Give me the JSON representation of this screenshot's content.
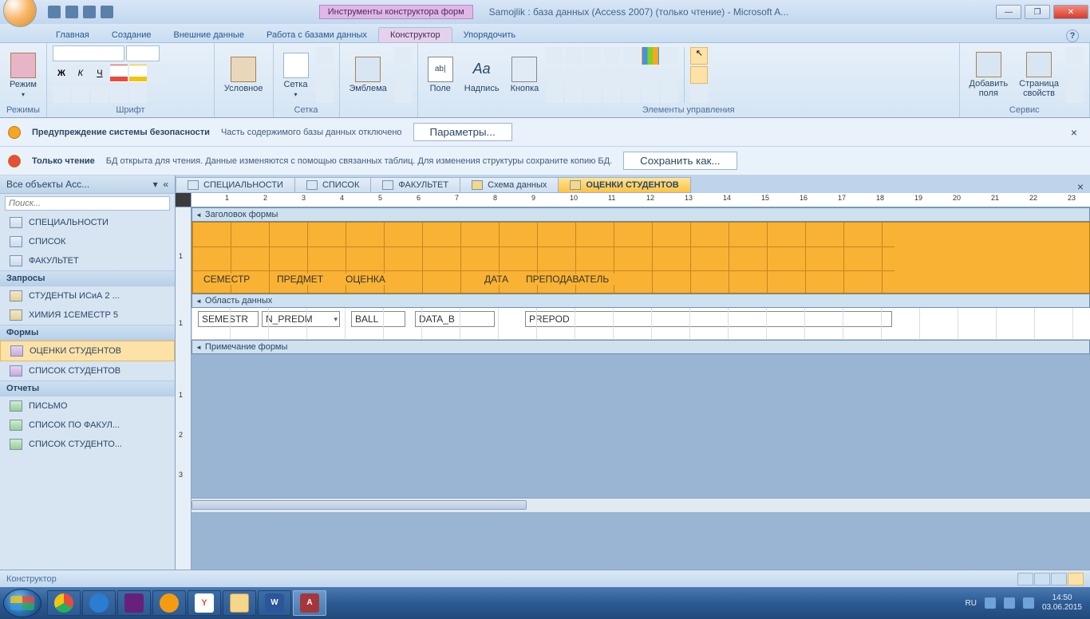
{
  "titlebar": {
    "context_label": "Инструменты конструктора форм",
    "app_title": "Samojlik : база данных (Access 2007) (только чтение) - Microsoft A..."
  },
  "ribbon_tabs": {
    "t0": "Главная",
    "t1": "Создание",
    "t2": "Внешние данные",
    "t3": "Работа с базами данных",
    "t4": "Конструктор",
    "t5": "Упорядочить"
  },
  "ribbon": {
    "mode": "Режим",
    "g_modes": "Режимы",
    "bold": "Ж",
    "italic": "К",
    "underline": "Ч",
    "g_font": "Шрифт",
    "cond": "Условное",
    "grid": "Сетка",
    "g_grid": "Сетка",
    "emblem": "Эмблема",
    "g_emblem": "",
    "field": "Поле",
    "label": "Надпись",
    "button": "Кнопка",
    "aa": "Aa",
    "g_controls": "Элементы управления",
    "addf": "Добавить\nполя",
    "props": "Страница\nсвойств",
    "g_service": "Сервис"
  },
  "warnings": {
    "sec_title": "Предупреждение системы безопасности",
    "sec_text": "Часть содержимого базы данных отключено",
    "sec_btn": "Параметры...",
    "ro_title": "Только чтение",
    "ro_text": "БД открыта для чтения. Данные изменяются с помощью связанных таблиц. Для изменения структуры сохраните копию БД.",
    "ro_btn": "Сохранить как..."
  },
  "nav": {
    "header": "Все объекты Acc...",
    "search_ph": "Поиск...",
    "sec_tables": "",
    "t0": "СПЕЦИАЛЬНОСТИ",
    "t1": "СПИСОК",
    "t2": "ФАКУЛЬТЕТ",
    "sec_queries": "Запросы",
    "q0": "СТУДЕНТЫ ИСиА 2 ...",
    "q1": "ХИМИЯ 1СЕМЕСТР 5",
    "sec_forms": "Формы",
    "f0": "ОЦЕНКИ СТУДЕНТОВ",
    "f1": "СПИСОК СТУДЕНТОВ",
    "sec_reports": "Отчеты",
    "r0": "ПИСЬМО",
    "r1": "СПИСОК ПО ФАКУЛ...",
    "r2": "СПИСОК СТУДЕНТО..."
  },
  "doctabs": {
    "d0": "СПЕЦИАЛЬНОСТИ",
    "d1": "СПИСОК",
    "d2": "ФАКУЛЬТЕТ",
    "d3": "Схема данных",
    "d4": "ОЦЕНКИ СТУДЕНТОВ"
  },
  "sections": {
    "header": "Заголовок формы",
    "detail": "Область данных",
    "footer": "Примечание формы"
  },
  "header_labels": {
    "l0": "СЕМЕСТР",
    "l1": "ПРЕДМЕТ",
    "l2": "ОЦЕНКА",
    "l3": "ДАТА",
    "l4": "ПРЕПОДАВАТЕЛЬ"
  },
  "controls": {
    "c0": "SEMESTR",
    "c1": "N_PREDM",
    "c2": "BALL",
    "c3": "DATA_B",
    "c4": "PREPOD"
  },
  "ruler_ticks": [
    "1",
    "2",
    "3",
    "4",
    "5",
    "6",
    "7",
    "8",
    "9",
    "10",
    "11",
    "12",
    "13",
    "14",
    "15",
    "16",
    "17",
    "18",
    "19",
    "20",
    "21",
    "22",
    "23"
  ],
  "status": {
    "mode": "Конструктор"
  },
  "tray": {
    "lang": "RU",
    "time": "14:50",
    "date": "03.06.2015"
  }
}
